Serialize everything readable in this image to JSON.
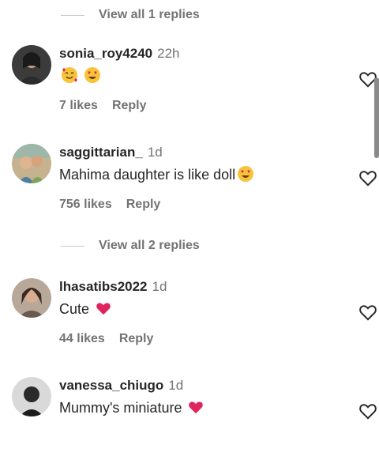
{
  "top_replies": {
    "label": "View all 1 replies"
  },
  "comments": [
    {
      "username": "sonia_roy4240",
      "time": "22h",
      "text": "",
      "emojis": [
        "smiling-face-with-hearts",
        "heart-eyes"
      ],
      "likes": "7 likes",
      "reply": "Reply"
    },
    {
      "username": "saggittarian_",
      "time": "1d",
      "text": "Mahima daughter is like doll",
      "emojis": [
        "heart-eyes"
      ],
      "likes": "756 likes",
      "reply": "Reply"
    },
    {
      "username": "lhasatibs2022",
      "time": "1d",
      "text": "Cute",
      "emojis": [
        "red-heart"
      ],
      "likes": "44 likes",
      "reply": "Reply"
    },
    {
      "username": "vanessa_chiugo",
      "time": "1d",
      "text": "Mummy's miniature",
      "emojis": [
        "red-heart"
      ],
      "likes": "",
      "reply": ""
    }
  ],
  "middle_replies": {
    "label": "View all 2 replies"
  },
  "colors": {
    "heart": "#e0245e",
    "muted": "#737373",
    "text": "#262626"
  },
  "icons": {
    "like": "heart-outline-icon"
  }
}
